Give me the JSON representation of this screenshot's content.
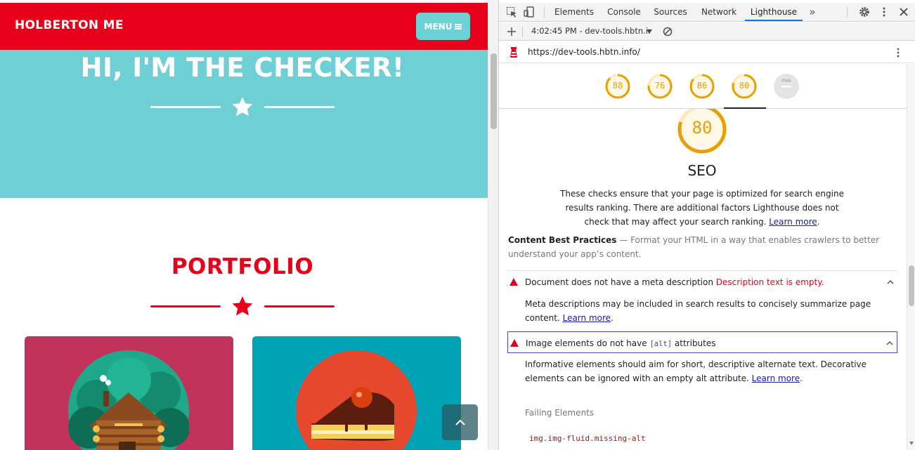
{
  "site": {
    "brand": "HOLBERTON ME",
    "menu_label": "MENU",
    "hero_title": "HI, I'M THE CHECKER!",
    "portfolio_title": "PORTFOLIO",
    "colors": {
      "primary": "#e8001a",
      "hero": "#6ecfd4",
      "card_cabin": "#c2325a",
      "card_cake": "#00a3b5"
    },
    "cards": [
      {
        "name": "cabin",
        "icon": "log-cabin-illustration"
      },
      {
        "name": "cake",
        "icon": "cake-slice-illustration"
      }
    ]
  },
  "devtools": {
    "tabs": [
      "Elements",
      "Console",
      "Sources",
      "Network",
      "Lighthouse"
    ],
    "active_tab": "Lighthouse",
    "more_tabs": "»",
    "toolbar": {
      "report_select": "4:02:45 PM - dev-tools.hbtn.info"
    },
    "url": "https://dev-tools.hbtn.info/",
    "scores": [
      {
        "value": "88"
      },
      {
        "value": "76"
      },
      {
        "value": "86"
      },
      {
        "value": "80"
      },
      {
        "value": "PWA"
      }
    ],
    "category": {
      "score": "80",
      "title": "SEO",
      "desc_1": "These checks ensure that your page is optimized for search engine results ranking. There are additional factors Lighthouse does not check that may affect your search ranking.",
      "learn_more": "Learn more",
      "period": "."
    },
    "group": {
      "title": "Content Best Practices",
      "separator": " — ",
      "desc": "Format your HTML in a way that enables crawlers to better understand your app’s content."
    },
    "audits": [
      {
        "title": "Document does not have a meta description",
        "error": "Description text is empty.",
        "desc": "Meta descriptions may be included in search results to concisely summarize page content.",
        "learn_more": "Learn more"
      },
      {
        "title_pre": "Image elements do not have",
        "title_code": "[alt]",
        "title_post": "attributes",
        "desc": "Informative elements should aim for short, descriptive alternate text. Decorative elements can be ignored with an empty alt attribute.",
        "learn_more": "Learn more"
      }
    ],
    "failing_label": "Failing Elements",
    "failing_item": "img.img-fluid.missing-alt",
    "colors": {
      "average": "#e8a000",
      "fail": "#e8001a"
    }
  }
}
